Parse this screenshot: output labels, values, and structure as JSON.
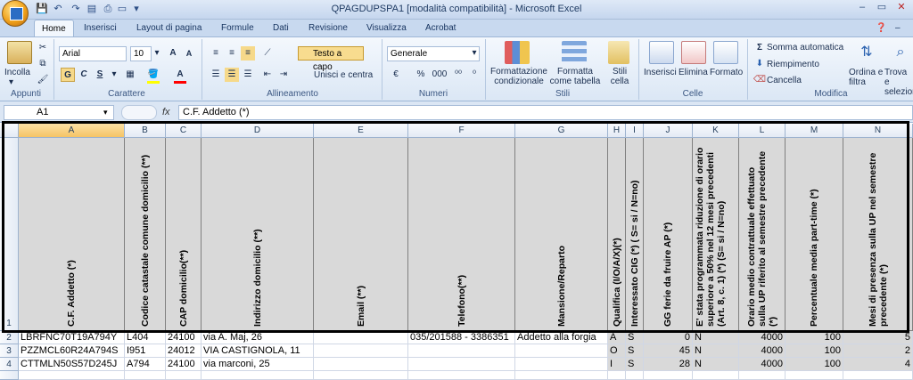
{
  "window": {
    "title": "QPAGDUPSPA1  [modalità compatibilità]  -  Microsoft Excel"
  },
  "tabs": [
    "Home",
    "Inserisci",
    "Layout di pagina",
    "Formule",
    "Dati",
    "Revisione",
    "Visualizza",
    "Acrobat"
  ],
  "ribbon": {
    "clipboard": {
      "paste_label": "Incolla",
      "group": "Appunti"
    },
    "font": {
      "name": "Arial",
      "size": "10",
      "bold": "G",
      "italic": "C",
      "underline": "S",
      "group": "Carattere"
    },
    "alignment": {
      "wrap": "Testo a capo",
      "merge": "Unisci e centra",
      "group": "Allineamento"
    },
    "number": {
      "format": "Generale",
      "percent": "%",
      "thousands": "000",
      "group": "Numeri"
    },
    "styles": {
      "cond": "Formattazione condizionale",
      "table": "Formatta come tabella",
      "cell": "Stili cella",
      "group": "Stili"
    },
    "cells": {
      "insert": "Inserisci",
      "delete": "Elimina",
      "format": "Formato",
      "group": "Celle"
    },
    "editing": {
      "autosum": "Somma automatica",
      "fill": "Riempimento",
      "clear": "Cancella",
      "sort": "Ordina e filtra",
      "find": "Trova e selezion",
      "group": "Modifica"
    }
  },
  "formula_bar": {
    "name_box": "A1",
    "fx": "fx",
    "content": "C.F. Addetto (*)"
  },
  "columns": [
    "A",
    "B",
    "C",
    "D",
    "E",
    "F",
    "G",
    "H",
    "I",
    "J",
    "K",
    "L",
    "M",
    "N"
  ],
  "rows": [
    "1",
    "2",
    "3",
    "4"
  ],
  "headers": [
    "C.F. Addetto (*)",
    "Codice catastale comune domicilio (**)",
    "CAP domicilio(**)",
    "Indirizzo domicilio (**)",
    "Email (**)",
    "Telefono(**)",
    "Mansione/Reparto",
    "Qualifica (I/O/A/X)(*)",
    "Interessato CIG (*) ( S= si / N=no)",
    "GG ferie da fruire AP (*)",
    "E' stata programmata riduzione di orario superiore a 50% nel 12 mesi precedenti (Art. 8, c. 1) (*) (S= si / N=no)",
    "Orario medio contrattuale effettuato sulla UP riferito al semestre precedente (*)",
    "Percentuale media part-time (*)",
    "Mesi di presenza sulla UP nel semestre precedente (*)"
  ],
  "data_rows": [
    [
      "LBRFNC70T19A794Y",
      "L404",
      "24100",
      "via A. Maj, 26",
      "",
      "035/201588 - 3386351",
      "Addetto alla forgia",
      "A",
      "S",
      "0",
      "N",
      "4000",
      "100",
      "5"
    ],
    [
      "PZZMCL60R24A794S",
      "I951",
      "24012",
      "VIA CASTIGNOLA, 11",
      "",
      "",
      "",
      "O",
      "S",
      "45",
      "N",
      "4000",
      "100",
      "2"
    ],
    [
      "CTTMLN50S57D245J",
      "A794",
      "24100",
      "via marconi, 25",
      "",
      "",
      "",
      "I",
      "S",
      "28",
      "N",
      "4000",
      "100",
      "4"
    ]
  ]
}
